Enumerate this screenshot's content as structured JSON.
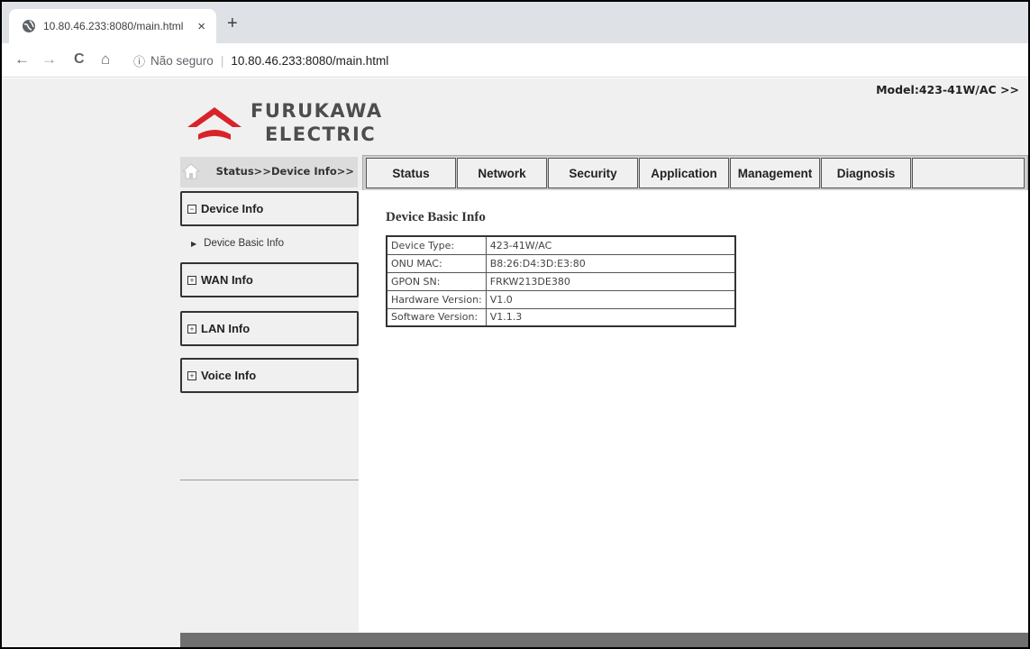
{
  "browser": {
    "tab_title": "10.80.46.233:8080/main.html",
    "tab_close": "×",
    "new_tab": "+",
    "back": "←",
    "forward": "→",
    "reload": "C",
    "home": "⌂",
    "info": "ⓘ",
    "insecure_label": "Não seguro",
    "separator": "|",
    "url": "10.80.46.233:8080/main.html"
  },
  "header": {
    "logo_line1": "FURUKAWA",
    "logo_line2": "ELECTRIC",
    "model": "Model:423-41W/AC >>"
  },
  "breadcrumb": "Status>>Device Info>>",
  "menu": [
    {
      "label": "Status"
    },
    {
      "label": "Network"
    },
    {
      "label": "Security"
    },
    {
      "label": "Application"
    },
    {
      "label": "Management"
    },
    {
      "label": "Diagnosis"
    }
  ],
  "sidebar": {
    "groups": [
      {
        "label": "Device Info",
        "expanded": true,
        "sign": "−"
      },
      {
        "label": "WAN Info",
        "expanded": false,
        "sign": "+"
      },
      {
        "label": "LAN Info",
        "expanded": false,
        "sign": "+"
      },
      {
        "label": "Voice Info",
        "expanded": false,
        "sign": "+"
      }
    ],
    "sub_item": "Device Basic Info",
    "sub_arrow": "▶"
  },
  "content": {
    "title": "Device Basic Info",
    "rows": [
      {
        "label": "Device Type:",
        "value": "423-41W/AC"
      },
      {
        "label": "ONU MAC:",
        "value": "B8:26:D4:3D:E3:80"
      },
      {
        "label": "GPON SN:",
        "value": "FRKW213DE380"
      },
      {
        "label": "Hardware Version:",
        "value": "V1.0"
      },
      {
        "label": "Software Version:",
        "value": "V1.1.3"
      }
    ]
  },
  "colors": {
    "logo_red": "#d7242a",
    "menu_bg": "#f0f0f0",
    "footer": "#707070"
  }
}
